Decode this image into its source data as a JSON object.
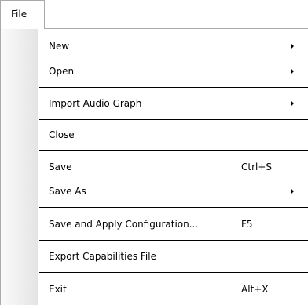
{
  "menubar": {
    "file_label": "File"
  },
  "menu": {
    "new": {
      "label": "New"
    },
    "open": {
      "label": "Open"
    },
    "import_audio_graph": {
      "label": "Import Audio Graph"
    },
    "close": {
      "label": "Close"
    },
    "save": {
      "label": "Save",
      "shortcut": "Ctrl+S"
    },
    "save_as": {
      "label": "Save As"
    },
    "save_apply": {
      "label": "Save and Apply Configuration...",
      "shortcut": "F5"
    },
    "export_capabilities": {
      "label": "Export Capabilities File"
    },
    "exit": {
      "label": "Exit",
      "shortcut": "Alt+X"
    }
  }
}
